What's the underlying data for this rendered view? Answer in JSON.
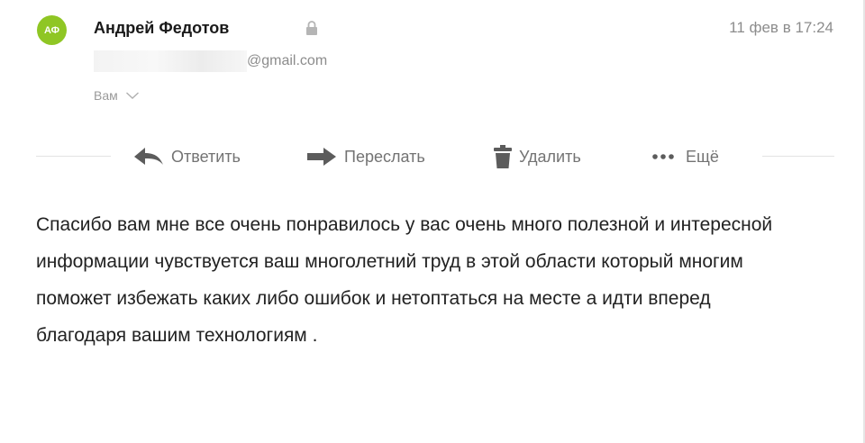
{
  "message": {
    "sender": {
      "initials": "АФ",
      "name": "Андрей Федотов",
      "email_domain": "@gmail.com",
      "avatar_color": "#8fc624"
    },
    "date": "11 фев в 17:24",
    "recipient_label": "Вам",
    "actions": {
      "reply": "Ответить",
      "forward": "Переслать",
      "delete": "Удалить",
      "more": "Ещё"
    },
    "body": "Спасибо вам мне все очень понравилось у вас очень много полезной и интересной информации чувствуется ваш многолетний труд в этой области который многим поможет избежать каких либо ошибок и нетоптаться на месте а идти вперед благодаря вашим технологиям ."
  },
  "icons": {
    "lock": "lock-icon",
    "chevron": "chevron-down-icon",
    "reply": "reply-arrow-icon",
    "forward": "forward-arrow-icon",
    "delete": "trash-icon",
    "more": "more-dots-icon"
  },
  "colors": {
    "text": "#222222",
    "muted": "#8c8c8c",
    "action": "#737373"
  }
}
